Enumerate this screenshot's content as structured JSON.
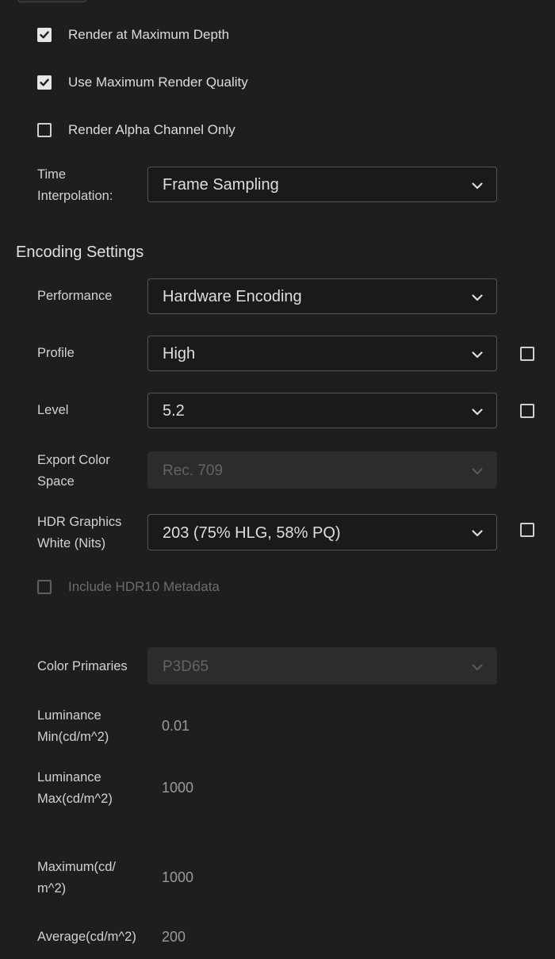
{
  "render_options": {
    "max_depth": {
      "label": "Render at Maximum Depth",
      "checked": true
    },
    "max_quality": {
      "label": "Use Maximum Render Quality",
      "checked": true
    },
    "alpha_only": {
      "label": "Render Alpha Channel Only",
      "checked": false
    },
    "time_interpolation": {
      "label_line1": "Time",
      "label_line2": "Interpolation:",
      "value": "Frame Sampling"
    }
  },
  "encoding": {
    "title": "Encoding Settings",
    "performance": {
      "label": "Performance",
      "value": "Hardware Encoding"
    },
    "profile": {
      "label": "Profile",
      "value": "High",
      "side_checked": false
    },
    "level": {
      "label": "Level",
      "value": "5.2",
      "side_checked": false
    },
    "export_color_space": {
      "label_line1": "Export Color",
      "label_line2": "Space",
      "value": "Rec. 709",
      "disabled": true
    },
    "hdr_white": {
      "label_line1": "HDR Graphics",
      "label_line2": "White (Nits)",
      "value": "203 (75% HLG, 58% PQ)",
      "side_checked": false
    },
    "hdr10_metadata": {
      "label": "Include HDR10 Metadata",
      "checked": false,
      "disabled": true
    },
    "color_primaries": {
      "label": "Color Primaries",
      "value": "P3D65",
      "disabled": true
    },
    "luminance_min": {
      "label_line1": "Luminance",
      "label_line2": "Min(cd/m^2)",
      "value": "0.01"
    },
    "luminance_max": {
      "label_line1": "Luminance",
      "label_line2": "Max(cd/m^2)",
      "value": "1000"
    },
    "maximum": {
      "label_line1": "Maximum(cd/",
      "label_line2": "m^2)",
      "value": "1000"
    },
    "average": {
      "label": "Average(cd/m^2)",
      "value": "200"
    }
  },
  "icons": {
    "checkmark": "checkmark-icon",
    "chevron": "chevron-down-icon"
  }
}
